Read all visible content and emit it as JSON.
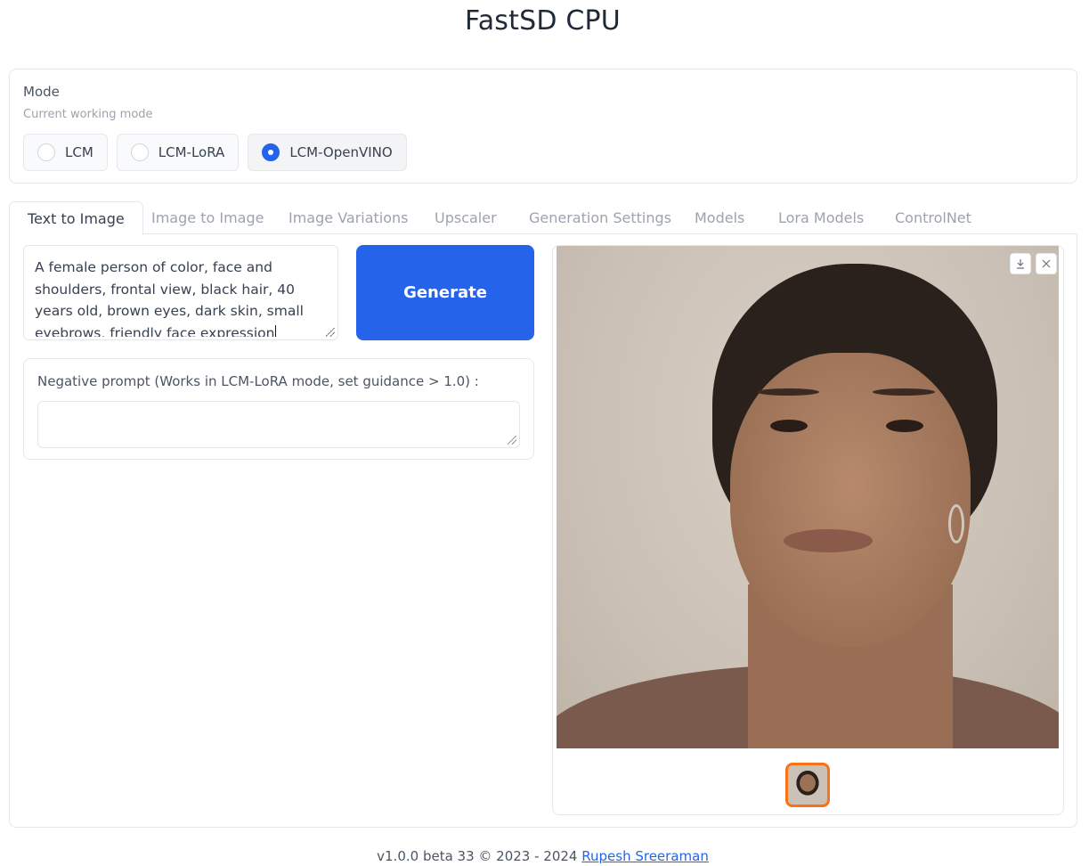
{
  "app": {
    "title": "FastSD CPU"
  },
  "mode": {
    "label": "Mode",
    "info": "Current working mode",
    "options": [
      "LCM",
      "LCM-LoRA",
      "LCM-OpenVINO"
    ],
    "selected": "LCM-OpenVINO"
  },
  "tabs": [
    "Text to Image",
    "Image to Image",
    "Image Variations",
    "Upscaler",
    "Generation Settings",
    "Models",
    "Lora Models",
    "ControlNet"
  ],
  "active_tab": "Text to Image",
  "prompt": {
    "value": "A female person of color, face and shoulders, frontal view, black hair, 40 years old, brown eyes, dark skin, small eyebrows, friendly face expression"
  },
  "generate_label": "Generate",
  "negative_prompt": {
    "label": "Negative prompt (Works in LCM-LoRA mode, set guidance > 1.0) :",
    "value": ""
  },
  "gallery": {
    "download_icon": "download-icon",
    "close_icon": "close-icon",
    "accent": "#f97316"
  },
  "footer": {
    "text": "v1.0.0 beta 33 © 2023 - 2024",
    "link": "Rupesh Sreeraman"
  },
  "colors": {
    "primary": "#2563eb",
    "thumb_border": "#f97316"
  }
}
